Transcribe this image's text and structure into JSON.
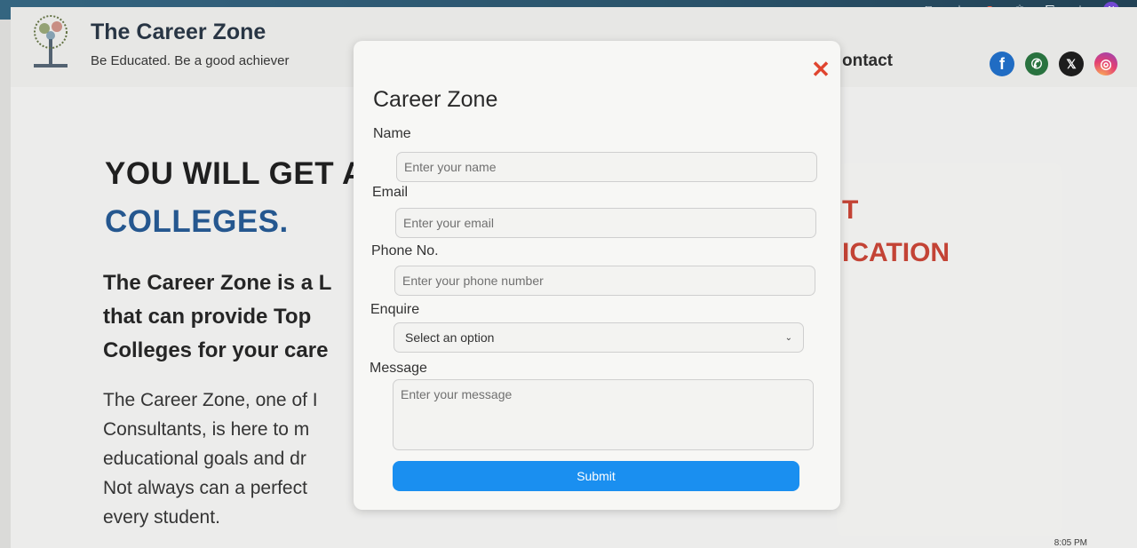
{
  "browser": {
    "icons": [
      "install-icon",
      "star-icon",
      "extension-c-icon",
      "react-devtools-icon",
      "puzzle-icon",
      "download-icon"
    ],
    "profile_initial": "N"
  },
  "header": {
    "brand_title": "The Career Zone",
    "brand_tagline": "Be Educated.  Be a good achiever",
    "nav_contact": "ontact"
  },
  "socials": [
    {
      "name": "facebook-icon",
      "glyph": "f"
    },
    {
      "name": "whatsapp-icon",
      "glyph": "✆"
    },
    {
      "name": "x-icon",
      "glyph": "𝕏"
    },
    {
      "name": "instagram-icon",
      "glyph": "◎"
    }
  ],
  "hero": {
    "line1": "YOU WILL GET A",
    "line2": "COLLEGES.",
    "sub_lines": [
      "The Career Zone is a L",
      "that can provide Top",
      "Colleges for your care"
    ],
    "body_lines": [
      "The Career Zone, one of I",
      "Consultants, is here to m",
      "educational goals and dr",
      "Not always can a perfect",
      "every student."
    ]
  },
  "side_card": {
    "line1": "T",
    "line2": "ICATION"
  },
  "modal": {
    "title": "Career Zone",
    "close_glyph": "✕",
    "name_label": "Name",
    "name_placeholder": "Enter your name",
    "email_label": "Email",
    "email_placeholder": "Enter your email",
    "phone_label": "Phone No.",
    "phone_placeholder": "Enter your phone number",
    "enquire_label": "Enquire",
    "enquire_selected": "Select an option",
    "message_label": "Message",
    "message_placeholder": "Enter your message",
    "submit_label": "Submit"
  },
  "taskbar": {
    "time": "8:05 PM"
  },
  "colors": {
    "accent_blue": "#1a8ff0",
    "close_red": "#e0452f",
    "heading_blue": "#1a4f8a",
    "card_red": "#c0392b"
  }
}
